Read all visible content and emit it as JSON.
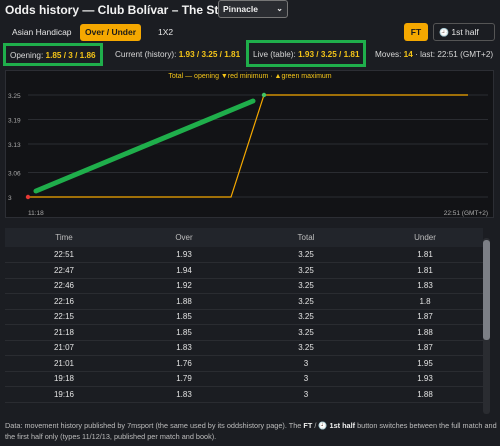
{
  "header": {
    "title": "Odds history — Club Bolívar – The Strongest",
    "bookmaker": "Pinnacle"
  },
  "tabs": [
    {
      "label": "Asian Handicap",
      "active": false
    },
    {
      "label": "Over / Under",
      "active": true
    },
    {
      "label": "1X2",
      "active": false
    }
  ],
  "period": {
    "ft_label": "FT",
    "half_icon": "clock-icon",
    "half_label": "1st half"
  },
  "stats": {
    "opening_label": "Opening:",
    "opening_value": "1.85 / 3 / 1.86",
    "current_label": "Current (history):",
    "current_value": "1.93 / 3.25 / 1.81",
    "live_label": "Live (table):",
    "live_value": "1.93 / 3.25 / 1.81",
    "moves_label": "Moves:",
    "moves_value": "14",
    "last_text": "· last: 22:51 (GMT+2)"
  },
  "chart_data": {
    "type": "line",
    "legend": "Total — opening ▼red minimum · ▲green maximum",
    "x_start_label": "11:18",
    "x_end_label": "22:51 (GMT+2)",
    "y_ticks": [
      "3.25",
      "3.19",
      "3.13",
      "3.06",
      "3"
    ],
    "ylim": [
      3,
      3.25
    ],
    "series": [
      {
        "values": [
          3,
          3,
          3,
          3.25,
          3.25
        ]
      }
    ],
    "min_marker": 3,
    "max_marker": 3.25,
    "colors": {
      "line": "#f5a800",
      "min": "#e53935",
      "max": "#43c463",
      "annotation": "#1fae4b"
    }
  },
  "table": {
    "headers": [
      "Time",
      "Over",
      "Total",
      "Under"
    ],
    "rows": [
      [
        "22:51",
        "1.93",
        "3.25",
        "1.81"
      ],
      [
        "22:47",
        "1.94",
        "3.25",
        "1.81"
      ],
      [
        "22:46",
        "1.92",
        "3.25",
        "1.83"
      ],
      [
        "22:16",
        "1.88",
        "3.25",
        "1.8"
      ],
      [
        "22:15",
        "1.85",
        "3.25",
        "1.87"
      ],
      [
        "21:18",
        "1.85",
        "3.25",
        "1.88"
      ],
      [
        "21:07",
        "1.83",
        "3.25",
        "1.87"
      ],
      [
        "21:01",
        "1.76",
        "3",
        "1.95"
      ],
      [
        "19:18",
        "1.79",
        "3",
        "1.93"
      ],
      [
        "19:16",
        "1.83",
        "3",
        "1.88"
      ]
    ]
  },
  "note": {
    "part1": "Data: movement history published by 7msport (the same used by its oddshistory page). The ",
    "ft": "FT",
    "sep": " / ",
    "half": "1st half",
    "part2": " button switches between the full match and the first half only (types 11/12/13, published per match and book)."
  }
}
